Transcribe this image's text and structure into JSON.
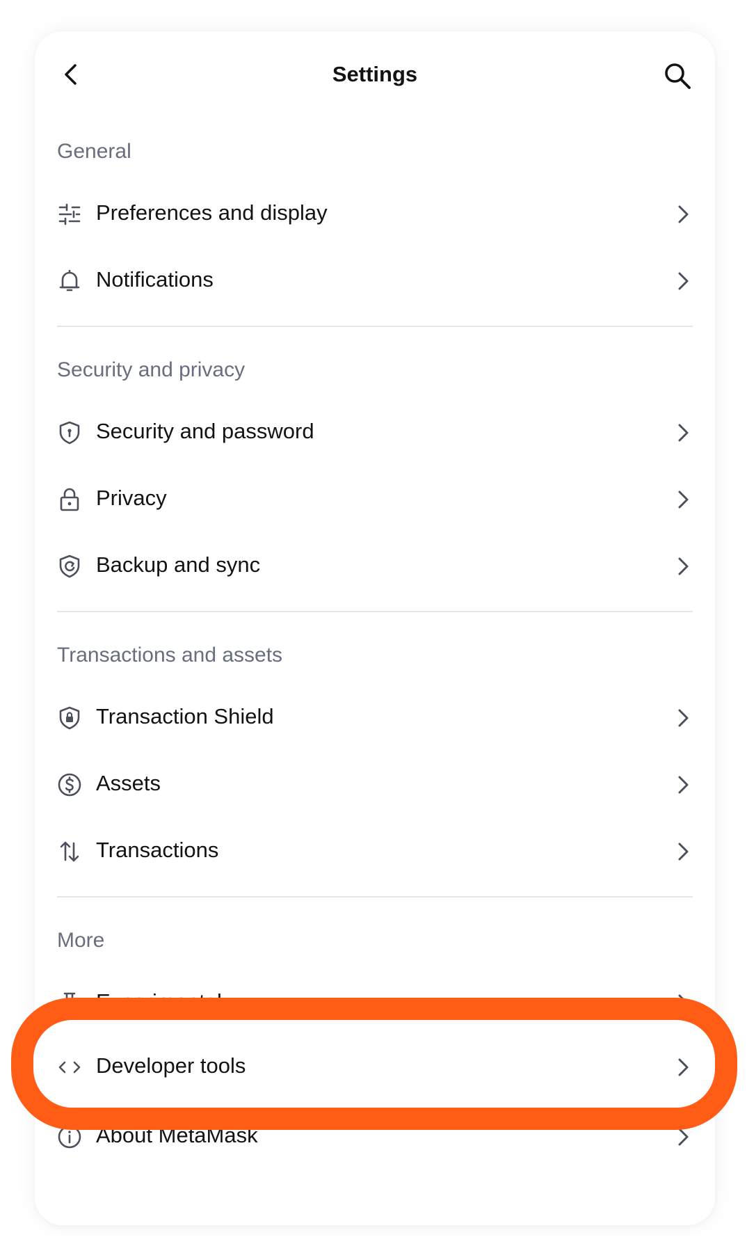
{
  "header": {
    "title": "Settings",
    "back_icon": "chevron-left-icon",
    "search_icon": "search-icon"
  },
  "sections": [
    {
      "label": "General",
      "items": [
        {
          "label": "Preferences and display",
          "icon": "sliders-icon"
        },
        {
          "label": "Notifications",
          "icon": "bell-icon"
        }
      ]
    },
    {
      "label": "Security and privacy",
      "items": [
        {
          "label": "Security and password",
          "icon": "shield-keyhole-icon"
        },
        {
          "label": "Privacy",
          "icon": "lock-icon"
        },
        {
          "label": "Backup and sync",
          "icon": "shield-sync-icon"
        }
      ]
    },
    {
      "label": "Transactions and assets",
      "items": [
        {
          "label": "Transaction Shield",
          "icon": "shield-lock-icon"
        },
        {
          "label": "Assets",
          "icon": "dollar-circle-icon"
        },
        {
          "label": "Transactions",
          "icon": "arrows-up-down-icon"
        }
      ]
    },
    {
      "label": "More",
      "items": [
        {
          "label": "Experimental",
          "icon": "flask-icon"
        },
        {
          "label": "Developer tools",
          "icon": "code-icon"
        },
        {
          "label": "About MetaMask",
          "icon": "info-icon"
        }
      ]
    }
  ],
  "highlight": {
    "color": "#ff5c16",
    "target": "Developer tools"
  },
  "colors": {
    "text": "#121314",
    "muted": "#686e7d",
    "divider": "#e5e6e9",
    "icon": "#4b505c"
  }
}
